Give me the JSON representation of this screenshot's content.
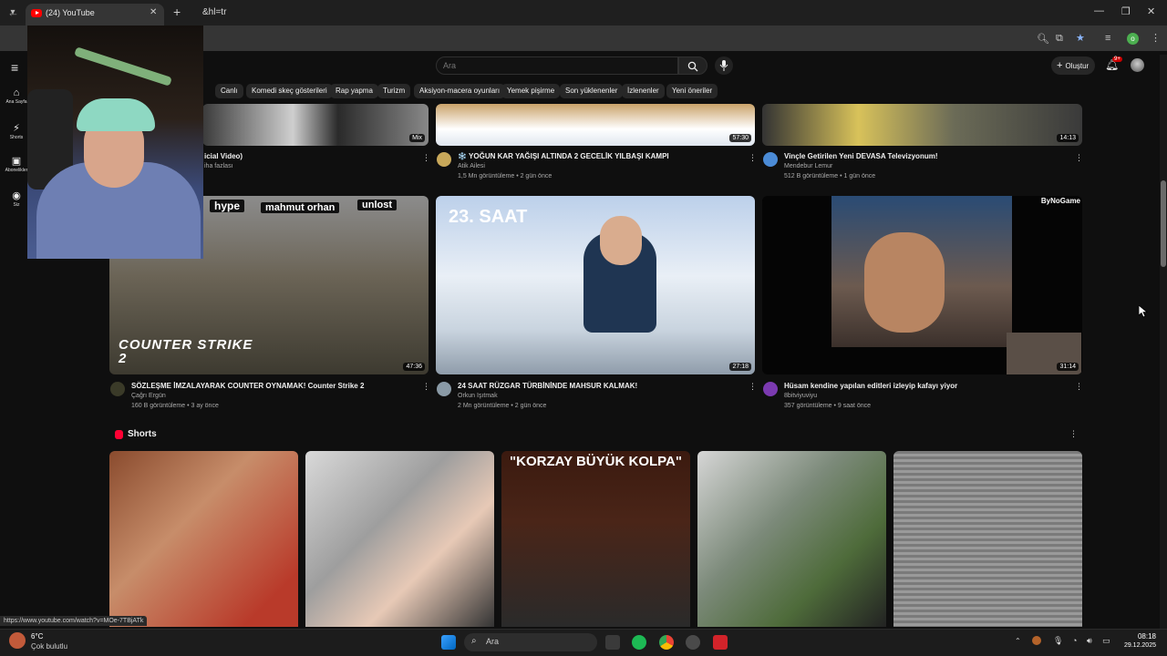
{
  "browser": {
    "tab_title": "(24) YouTube",
    "url": "&hl=tr",
    "profile_letter": "o"
  },
  "youtube": {
    "search_placeholder": "Ara",
    "create_label": "Oluştur",
    "notif_count": "9+",
    "sidebar": [
      {
        "label": "Ana Sayfa",
        "icon": "home-icon"
      },
      {
        "label": "Shorts",
        "icon": "shorts-icon"
      },
      {
        "label": "Abonelikler",
        "icon": "subscriptions-icon"
      },
      {
        "label": "Siz",
        "icon": "you-icon"
      }
    ],
    "chips": [
      "Canlı",
      "Komedi skeç gösterileri",
      "Rap yapma",
      "Turizm",
      "Aksiyon-macera oyunları",
      "Yemek pişirme",
      "Son yüklenenler",
      "İzlenenler",
      "Yeni öneriler"
    ],
    "row1": [
      {
        "title": "icial Video)",
        "channel": "iha fazlası",
        "stats": "",
        "duration": "Mix"
      },
      {
        "title": "❄️ YOĞUN KAR YAĞIŞI ALTINDA 2 GECELİK YILBAŞI KAMPI",
        "channel": "Atik Ailesi",
        "stats": "1,5 Mn görüntüleme • 2 gün önce",
        "duration": "57:30"
      },
      {
        "title": "Vinçle Getirilen Yeni DEVASA Televizyonum!",
        "channel": "Mendebur Lemur",
        "stats": "512 B görüntüleme • 1 gün önce",
        "duration": "14:13"
      }
    ],
    "row2": [
      {
        "title": "SÖZLEŞME İMZALAYARAK COUNTER OYNAMAK! Counter Strike 2",
        "channel": "Çağrı Ergün",
        "stats": "160 B görüntüleme • 3 ay önce",
        "duration": "47:36",
        "thumb_tags": [
          "hype",
          "mahmut orhan",
          "unlost"
        ],
        "thumb_logo": "COUNTER STRIKE 2"
      },
      {
        "title": "24 SAAT RÜZGAR TÜRBİNİNDE MAHSUR KALMAK!",
        "channel": "Orkun Işıtmak",
        "stats": "2 Mn görüntüleme • 2 gün önce",
        "duration": "27:18",
        "thumb_text": "23. SAAT"
      },
      {
        "title": "Hüsam kendine yapılan editleri izleyip kafayı yiyor",
        "channel": "8bitviyuviyu",
        "stats": "357 görüntüleme • 9 saat önce",
        "duration": "31:14",
        "thumb_brand": "ByNoGame"
      }
    ],
    "shorts_heading": "Shorts",
    "shorts_text_3": "\"KORZAY BÜYÜK KOLPA\""
  },
  "status_link": "https://www.youtube.com/watch?v=MOe-7TBjATk",
  "taskbar": {
    "temp": "6°C",
    "weather": "Çok bulutlu",
    "search_label": "Ara",
    "time": "08:18",
    "date": "29.12.2025"
  }
}
